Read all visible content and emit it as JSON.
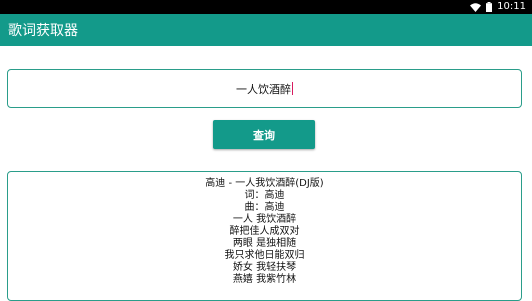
{
  "status_bar": {
    "time": "10:11",
    "wifi_icon": "wifi-icon",
    "battery_icon": "battery-icon"
  },
  "app_bar": {
    "title": "歌词获取器"
  },
  "search": {
    "value": "一人饮酒醉"
  },
  "search_button": {
    "label": "查询"
  },
  "result": {
    "lines": [
      "高迪 - 一人我饮酒醉(DJ版)",
      "词：高迪",
      "曲：高迪",
      "一人 我饮酒醉",
      "醉把佳人成双对",
      "两眼 是独相随",
      "我只求他日能双归",
      "娇女 我轻扶琴",
      "燕嬉 我紫竹林"
    ]
  },
  "colors": {
    "accent": "#139a8a",
    "border": "#2a9d8a",
    "caret": "#d81b60"
  }
}
